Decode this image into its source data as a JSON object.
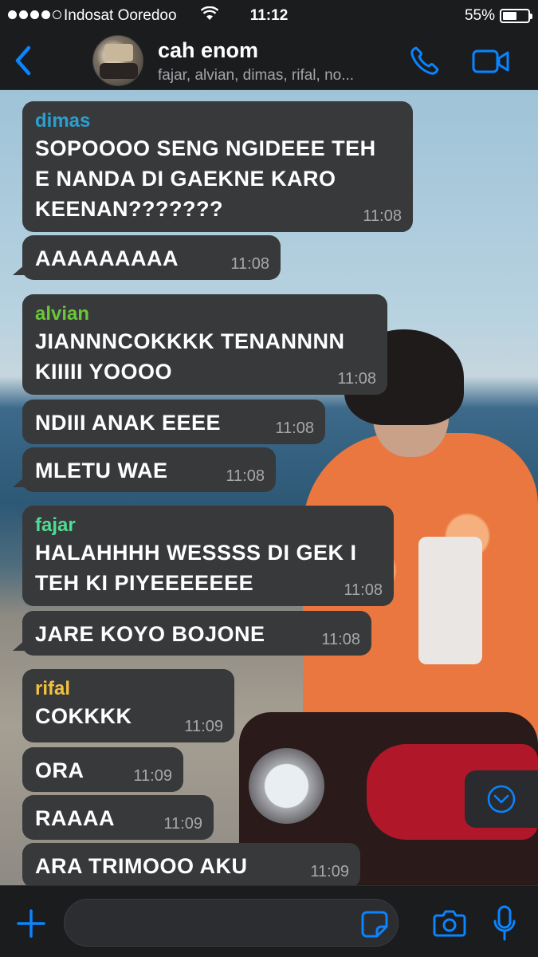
{
  "status": {
    "carrier": "Indosat Ooredoo",
    "time": "11:12",
    "battery_pct": "55%",
    "battery_level": 0.55
  },
  "header": {
    "back_icon": "chevron-left-icon",
    "group_name": "cah enom",
    "members": "fajar, alvian, dimas, rifal, no..."
  },
  "colors": {
    "accent": "#0a84ff",
    "dimas": "#2c9fd1",
    "alvian": "#6bc73a",
    "fajar": "#4fdc94",
    "rifal": "#f1c040",
    "bubble": "#38393b"
  },
  "messages": [
    {
      "sender": "dimas",
      "text": "SOPOOOO SENG NGIDEEE TEH\nE NANDA DI GAEKNE KARO\nKEENAN???????",
      "time": "11:08"
    },
    {
      "sender": "",
      "text": "AAAAAAAAA",
      "time": "11:08"
    },
    {
      "sender": "alvian",
      "text": "JIANNNCOKKKK TENANNNN\nKIIIII YOOOO",
      "time": "11:08"
    },
    {
      "sender": "",
      "text": "NDIII ANAK EEEE",
      "time": "11:08"
    },
    {
      "sender": "",
      "text": "MLETU WAE",
      "time": "11:08"
    },
    {
      "sender": "fajar",
      "text": "HALAHHHH WESSSS DI GEK I\nTEH KI PIYEEEEEEE",
      "time": "11:08"
    },
    {
      "sender": "",
      "text": "JARE KOYO BOJONE",
      "time": "11:08"
    },
    {
      "sender": "rifal",
      "text": "COKKKK",
      "time": "11:09"
    },
    {
      "sender": "",
      "text": "ORA",
      "time": "11:09"
    },
    {
      "sender": "",
      "text": "RAAAA",
      "time": "11:09"
    },
    {
      "sender": "",
      "text": "ARA TRIMOOO AKU",
      "time": "11:09"
    }
  ],
  "input": {
    "placeholder": ""
  }
}
